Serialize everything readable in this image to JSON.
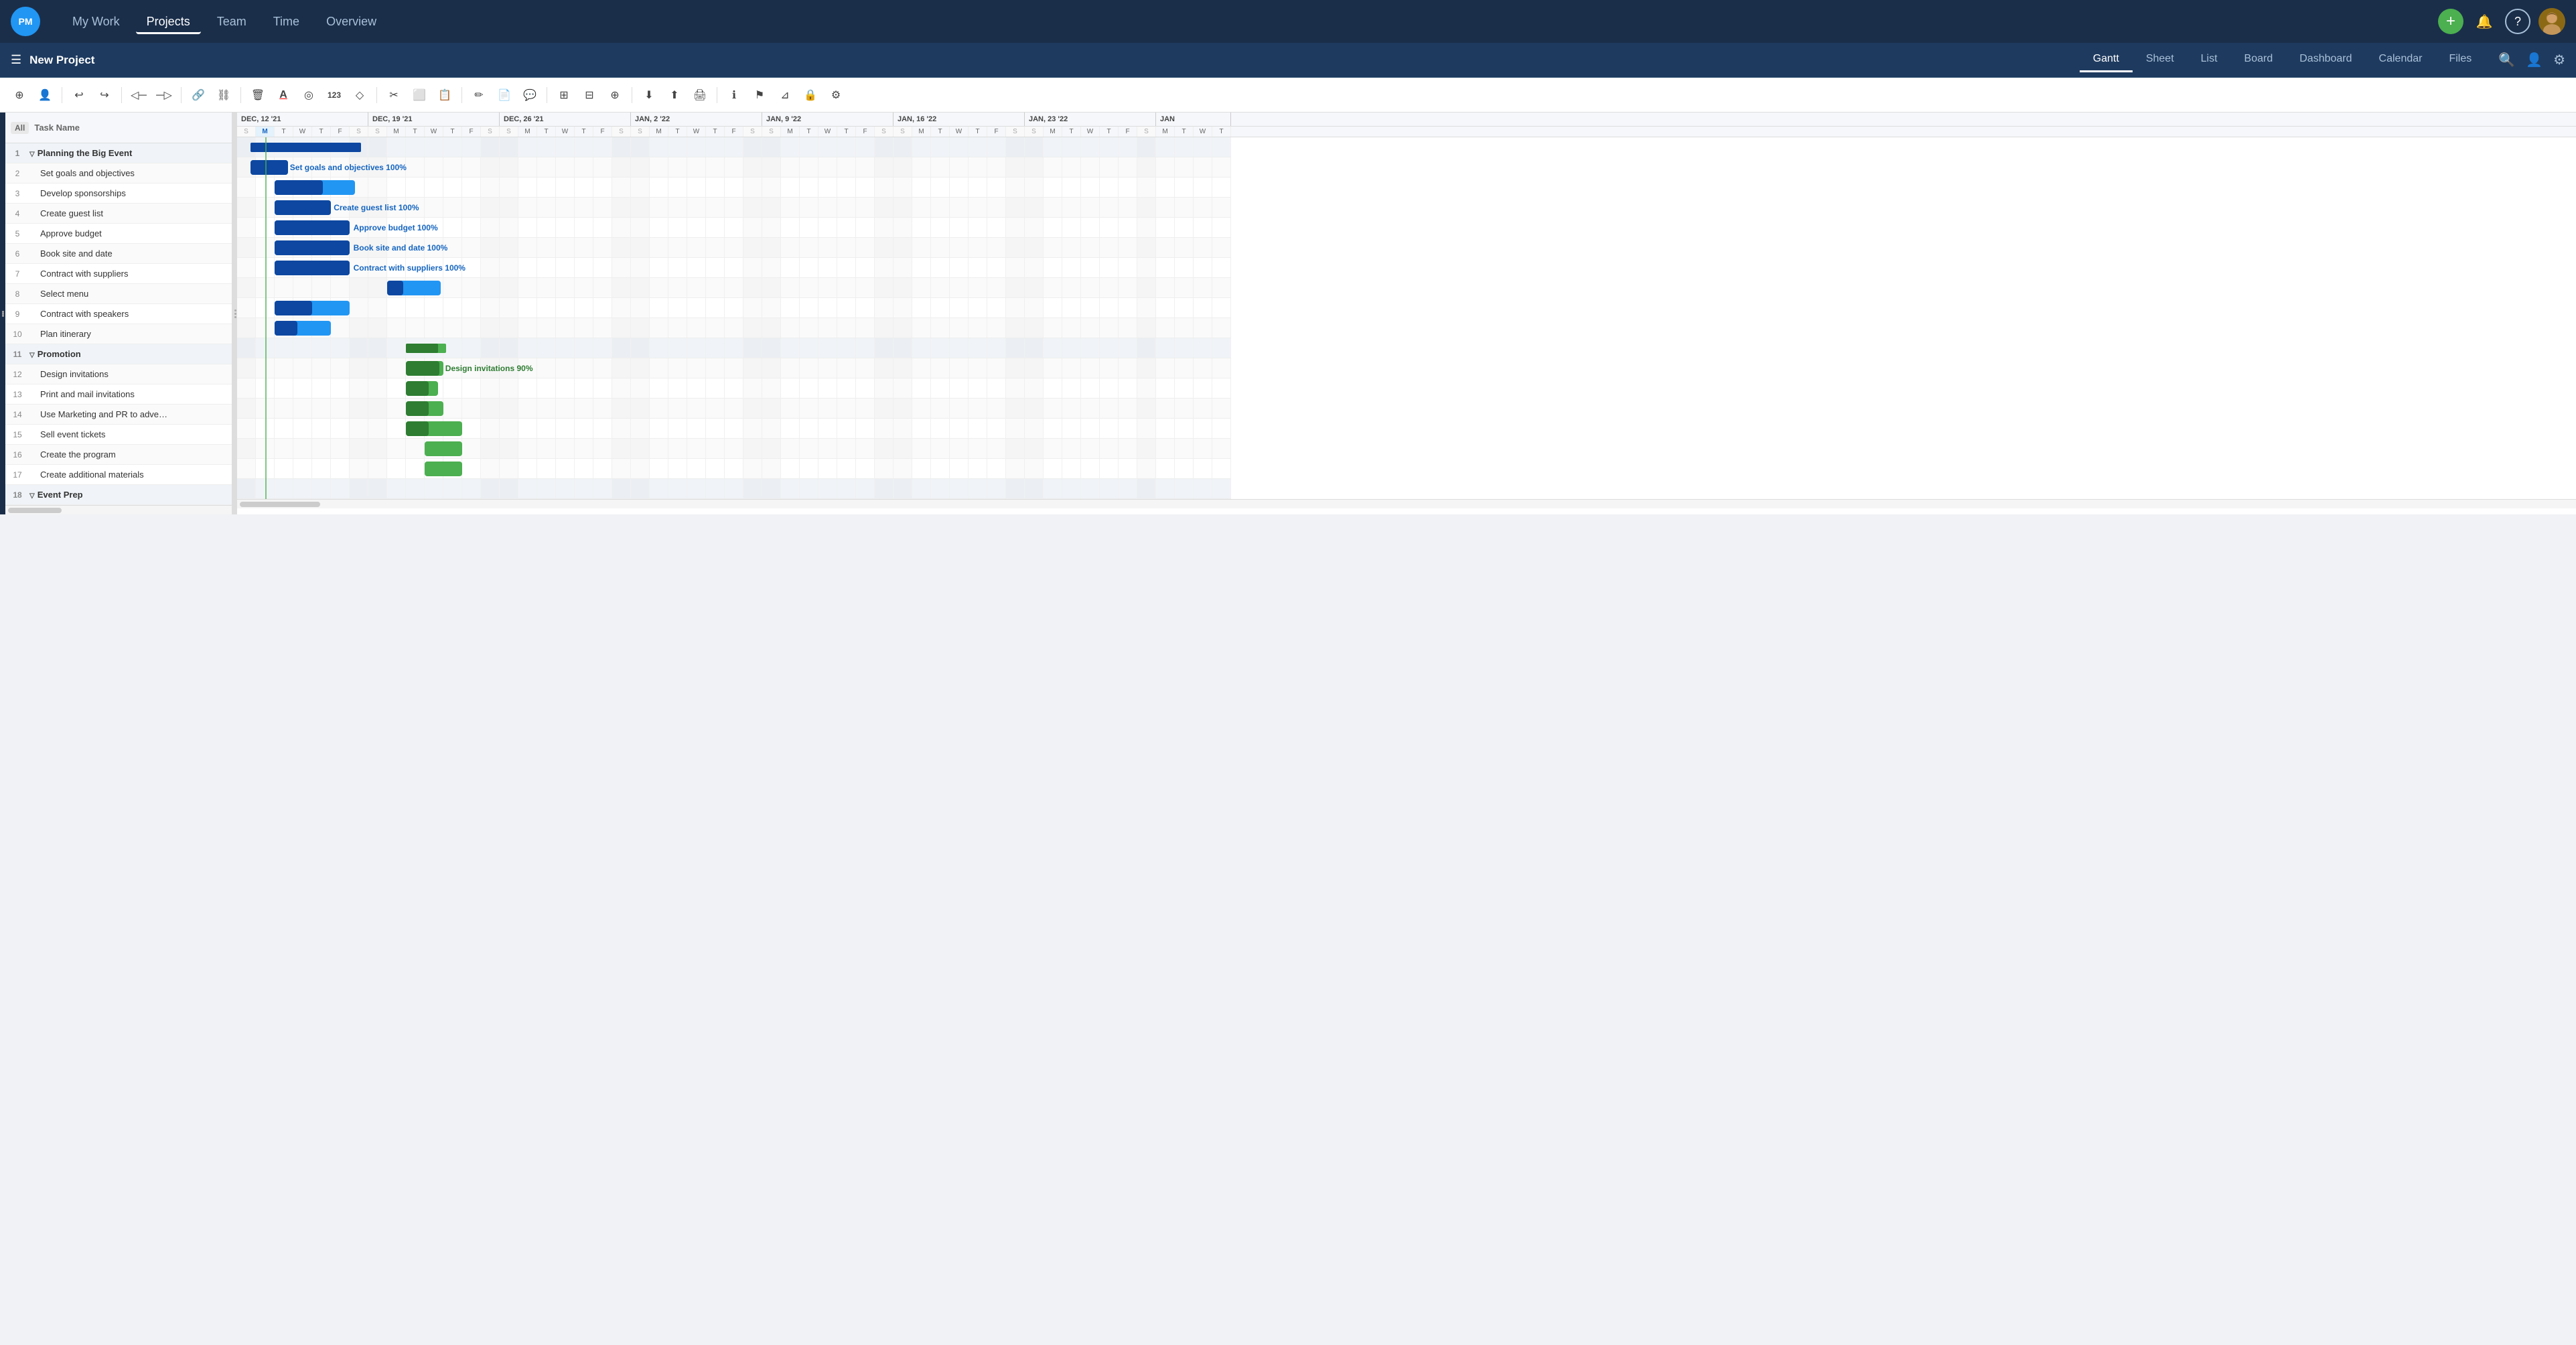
{
  "app": {
    "logo": "PM",
    "nav_items": [
      "My Work",
      "Projects",
      "Team",
      "Time",
      "Overview"
    ],
    "active_nav": "Projects"
  },
  "project": {
    "title": "New Project",
    "views": [
      "Gantt",
      "Sheet",
      "List",
      "Board",
      "Dashboard",
      "Calendar",
      "Files"
    ],
    "active_view": "Gantt"
  },
  "toolbar": {
    "tools": [
      {
        "name": "add-task",
        "icon": "⊕"
      },
      {
        "name": "assign-user",
        "icon": "👤"
      },
      {
        "name": "undo",
        "icon": "↩"
      },
      {
        "name": "redo",
        "icon": "↪"
      },
      {
        "name": "outdent",
        "icon": "◁"
      },
      {
        "name": "indent",
        "icon": "▷"
      },
      {
        "name": "link",
        "icon": "🔗"
      },
      {
        "name": "unlink",
        "icon": "⛓"
      },
      {
        "name": "delete",
        "icon": "🗑"
      },
      {
        "name": "text-color",
        "icon": "A"
      },
      {
        "name": "fill-color",
        "icon": "◎"
      },
      {
        "name": "number",
        "icon": "123"
      },
      {
        "name": "diamond",
        "icon": "◇"
      },
      {
        "name": "cut",
        "icon": "✂"
      },
      {
        "name": "copy",
        "icon": "⬜"
      },
      {
        "name": "paste",
        "icon": "📋"
      },
      {
        "name": "pencil",
        "icon": "✏"
      },
      {
        "name": "notes",
        "icon": "📄"
      },
      {
        "name": "comment",
        "icon": "💬"
      },
      {
        "name": "columns",
        "icon": "⊞"
      },
      {
        "name": "table",
        "icon": "⊟"
      },
      {
        "name": "zoom",
        "icon": "⊕"
      },
      {
        "name": "export-down",
        "icon": "⬇"
      },
      {
        "name": "export-up",
        "icon": "⬆"
      },
      {
        "name": "print",
        "icon": "🖨"
      },
      {
        "name": "info",
        "icon": "ℹ"
      },
      {
        "name": "filter-flag",
        "icon": "⚑"
      },
      {
        "name": "filter",
        "icon": "⊿"
      },
      {
        "name": "lock",
        "icon": "🔒"
      },
      {
        "name": "settings",
        "icon": "⚙"
      }
    ]
  },
  "columns": {
    "all_label": "All",
    "task_name_label": "Task Name"
  },
  "tasks": [
    {
      "id": 1,
      "num": 1,
      "name": "Planning the Big Event",
      "indent": 0,
      "is_group": true,
      "collapse": true,
      "selected": true
    },
    {
      "id": 2,
      "num": 2,
      "name": "Set goals and objectives",
      "indent": 1,
      "is_group": false
    },
    {
      "id": 3,
      "num": 3,
      "name": "Develop sponsorships",
      "indent": 1,
      "is_group": false
    },
    {
      "id": 4,
      "num": 4,
      "name": "Create guest list",
      "indent": 1,
      "is_group": false
    },
    {
      "id": 5,
      "num": 5,
      "name": "Approve budget",
      "indent": 1,
      "is_group": false
    },
    {
      "id": 6,
      "num": 6,
      "name": "Book site and date",
      "indent": 1,
      "is_group": false
    },
    {
      "id": 7,
      "num": 7,
      "name": "Contract with suppliers",
      "indent": 1,
      "is_group": false
    },
    {
      "id": 8,
      "num": 8,
      "name": "Select menu",
      "indent": 1,
      "is_group": false
    },
    {
      "id": 9,
      "num": 9,
      "name": "Contract with speakers",
      "indent": 1,
      "is_group": false
    },
    {
      "id": 10,
      "num": 10,
      "name": "Plan itinerary",
      "indent": 1,
      "is_group": false
    },
    {
      "id": 11,
      "num": 11,
      "name": "Promotion",
      "indent": 0,
      "is_group": true,
      "collapse": true
    },
    {
      "id": 12,
      "num": 12,
      "name": "Design invitations",
      "indent": 1,
      "is_group": false
    },
    {
      "id": 13,
      "num": 13,
      "name": "Print and mail invitations",
      "indent": 1,
      "is_group": false
    },
    {
      "id": 14,
      "num": 14,
      "name": "Use Marketing and PR to adve…",
      "indent": 1,
      "is_group": false
    },
    {
      "id": 15,
      "num": 15,
      "name": "Sell event tickets",
      "indent": 1,
      "is_group": false
    },
    {
      "id": 16,
      "num": 16,
      "name": "Create the program",
      "indent": 1,
      "is_group": false
    },
    {
      "id": 17,
      "num": 17,
      "name": "Create additional materials",
      "indent": 1,
      "is_group": false
    },
    {
      "id": 18,
      "num": 18,
      "name": "Event Prep",
      "indent": 0,
      "is_group": true,
      "collapse": true
    }
  ],
  "date_headers": [
    {
      "label": "DEC, 12 '21",
      "days": 7
    },
    {
      "label": "DEC, 19 '21",
      "days": 7
    },
    {
      "label": "DEC, 26 '21",
      "days": 7
    },
    {
      "label": "JAN, 2 '22",
      "days": 7
    },
    {
      "label": "JAN, 9 '22",
      "days": 7
    },
    {
      "label": "JAN, 16 '22",
      "days": 7
    },
    {
      "label": "JAN, 23 '22",
      "days": 7
    },
    {
      "label": "JAN",
      "days": 4
    }
  ],
  "day_labels": [
    "S",
    "M",
    "T",
    "W",
    "T",
    "F",
    "S",
    "S",
    "M",
    "T",
    "W",
    "T",
    "F",
    "S",
    "S",
    "M",
    "T",
    "W",
    "T",
    "F",
    "S",
    "S",
    "M",
    "T",
    "W",
    "T",
    "F",
    "S",
    "S",
    "M",
    "T",
    "W",
    "T",
    "F",
    "S",
    "S",
    "M",
    "T",
    "W",
    "T",
    "F",
    "S",
    "S",
    "M",
    "T",
    "W",
    "T",
    "F",
    "S",
    "M",
    "T",
    "W",
    "T"
  ],
  "gantt_bars": [
    {
      "row": 1,
      "start": 10,
      "width": 165,
      "type": "blue",
      "progress": 100,
      "label": "",
      "is_group": true
    },
    {
      "row": 2,
      "start": 10,
      "width": 56,
      "type": "blue",
      "progress": 100,
      "label": "Set goals and objectives  100%"
    },
    {
      "row": 3,
      "start": 28,
      "width": 120,
      "type": "blue",
      "progress": 60,
      "label": ""
    },
    {
      "row": 4,
      "start": 28,
      "width": 84,
      "type": "blue",
      "progress": 100,
      "label": "Create guest list  100%"
    },
    {
      "row": 5,
      "start": 28,
      "width": 112,
      "type": "blue",
      "progress": 100,
      "label": "Approve budget  100%"
    },
    {
      "row": 6,
      "start": 28,
      "width": 112,
      "type": "blue",
      "progress": 100,
      "label": "Book site and date  100%"
    },
    {
      "row": 7,
      "start": 28,
      "width": 112,
      "type": "blue",
      "progress": 100,
      "label": "Contract with suppliers  100%"
    },
    {
      "row": 8,
      "start": 112,
      "width": 80,
      "type": "blue",
      "progress": 30,
      "label": ""
    },
    {
      "row": 9,
      "start": 28,
      "width": 112,
      "type": "blue",
      "progress": 50,
      "label": ""
    },
    {
      "row": 10,
      "start": 28,
      "width": 84,
      "type": "blue",
      "progress": 40,
      "label": ""
    },
    {
      "row": 11,
      "start": 126,
      "width": 60,
      "type": "green",
      "progress": 80,
      "label": "",
      "is_group": true
    },
    {
      "row": 12,
      "start": 126,
      "width": 56,
      "type": "green",
      "progress": 90,
      "label": "Design invitations  90%"
    },
    {
      "row": 13,
      "start": 126,
      "width": 48,
      "type": "green",
      "progress": 70,
      "label": ""
    },
    {
      "row": 14,
      "start": 126,
      "width": 56,
      "type": "green",
      "progress": 60,
      "label": ""
    },
    {
      "row": 15,
      "start": 126,
      "width": 84,
      "type": "green",
      "progress": 40,
      "label": ""
    },
    {
      "row": 16,
      "start": 140,
      "width": 56,
      "type": "green",
      "progress": 0,
      "label": ""
    },
    {
      "row": 17,
      "start": 140,
      "width": 56,
      "type": "green",
      "progress": 0,
      "label": ""
    },
    {
      "row": 18,
      "start": 0,
      "width": 0,
      "type": "blue",
      "progress": 0,
      "label": ""
    }
  ],
  "colors": {
    "nav_bg": "#1a2e4a",
    "secondary_nav_bg": "#1e3a5f",
    "accent_blue": "#2196f3",
    "accent_green": "#4caf50",
    "today_line": "#4CAF50"
  }
}
